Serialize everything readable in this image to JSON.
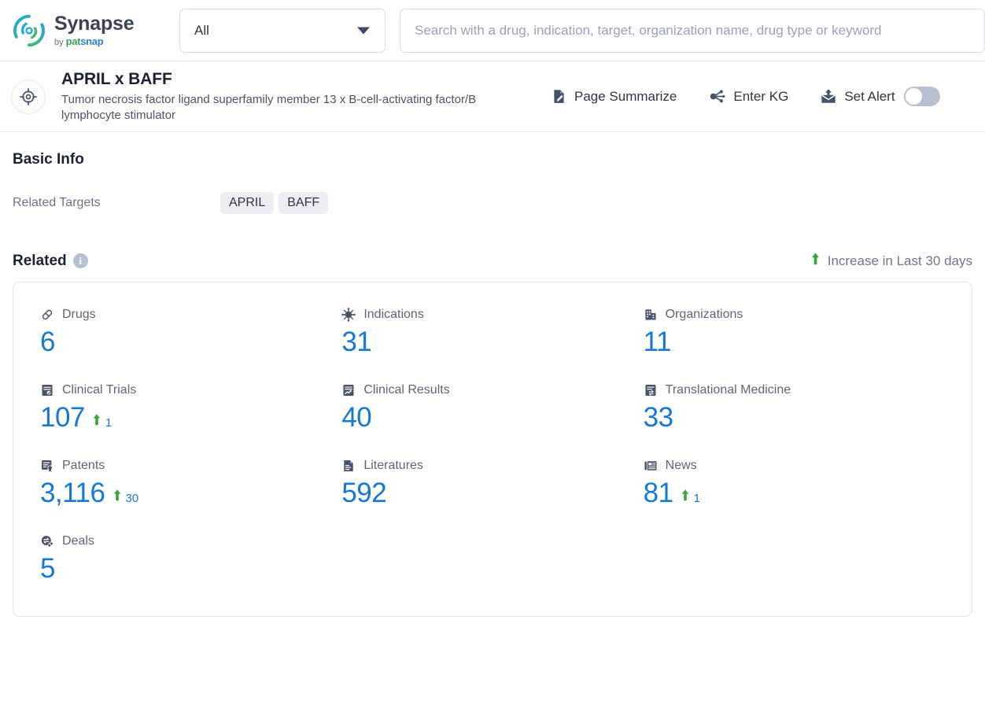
{
  "brand": {
    "name": "Synapse",
    "by": "by",
    "patsnap_pat": "pat",
    "patsnap_snap": "snap",
    "logo_icon": "synapse-circular-logo"
  },
  "search": {
    "scope_value": "All",
    "scope_caret_icon": "chevron-down-icon",
    "placeholder": "Search with a drug, indication, target, organization name, drug type or keyword",
    "value": ""
  },
  "entity": {
    "avatar_icon": "target-crosshair-icon",
    "name": "APRIL x BAFF",
    "description": "Tumor necrosis factor ligand superfamily member 13 x B-cell-activating factor/B lymphocyte stimulator"
  },
  "header_actions": [
    {
      "label": "Page Summarize",
      "icon": "document-edit-icon"
    },
    {
      "label": "Enter KG",
      "icon": "knowledge-graph-icon"
    },
    {
      "label": "Set Alert",
      "icon": "alert-envelope-icon",
      "toggle": true,
      "toggle_on": false
    }
  ],
  "basic_info": {
    "title": "Basic Info",
    "related_targets_label": "Related Targets",
    "related_targets": [
      "APRIL",
      "BAFF"
    ]
  },
  "related": {
    "title": "Related",
    "info_icon": "info-icon",
    "info_glyph": "i",
    "legend_label": "Increase in Last 30 days",
    "legend_arrow_icon": "arrow-up-icon",
    "increase_color": "#3fa23f",
    "value_color": "#1677d6",
    "stats": [
      {
        "label": "Drugs",
        "value": "6",
        "icon": "pill-capsule-icon",
        "delta": null
      },
      {
        "label": "Indications",
        "value": "31",
        "icon": "virus-icon",
        "delta": null
      },
      {
        "label": "Organizations",
        "value": "11",
        "icon": "building-icon",
        "delta": null
      },
      {
        "label": "Clinical Trials",
        "value": "107",
        "icon": "clinical-trial-document-icon",
        "delta": "1"
      },
      {
        "label": "Clinical Results",
        "value": "40",
        "icon": "results-chart-document-icon",
        "delta": null
      },
      {
        "label": "Translational Medicine",
        "value": "33",
        "icon": "translational-document-icon",
        "delta": null
      },
      {
        "label": "Patents",
        "value": "3,116",
        "icon": "patent-certificate-icon",
        "delta": "30"
      },
      {
        "label": "Literatures",
        "value": "592",
        "icon": "literature-document-icon",
        "delta": null
      },
      {
        "label": "News",
        "value": "81",
        "icon": "news-paper-icon",
        "delta": "1"
      },
      {
        "label": "Deals",
        "value": "5",
        "icon": "deals-exchange-icon",
        "delta": null
      }
    ]
  }
}
